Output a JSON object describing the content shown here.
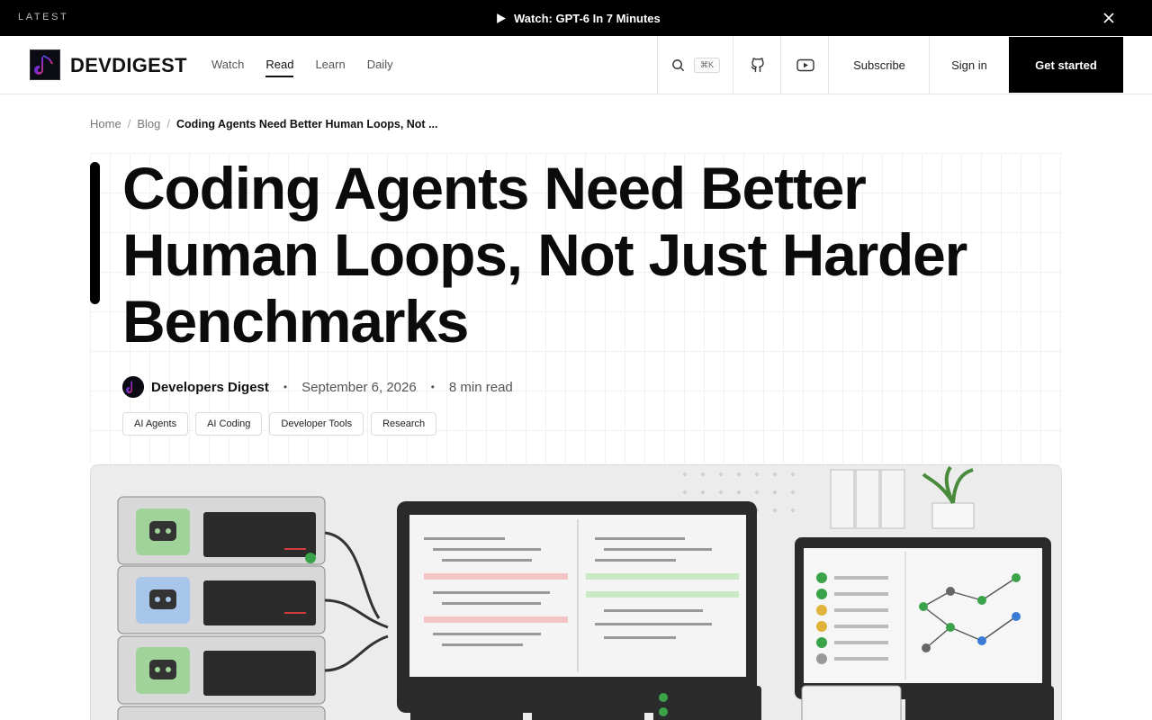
{
  "announcement": {
    "label": "LATEST",
    "link_text": "Watch: GPT-6 In 7 Minutes"
  },
  "header": {
    "brand": "DEVDIGEST",
    "nav": [
      {
        "label": "Watch",
        "active": false
      },
      {
        "label": "Read",
        "active": true
      },
      {
        "label": "Learn",
        "active": false
      },
      {
        "label": "Daily",
        "active": false
      }
    ],
    "search_shortcut": "⌘K",
    "subscribe_label": "Subscribe",
    "signin_label": "Sign in",
    "cta_label": "Get started"
  },
  "breadcrumb": {
    "home": "Home",
    "blog": "Blog",
    "current": "Coding Agents Need Better Human Loops, Not ..."
  },
  "article": {
    "title": "Coding Agents Need Better Human Loops, Not Just Harder Benchmarks",
    "author": "Developers Digest",
    "date": "September 6, 2026",
    "read_time": "8 min read",
    "tags": [
      "AI Agents",
      "AI Coding",
      "Developer Tools",
      "Research"
    ]
  },
  "colors": {
    "topbar_bg": "#000000",
    "cta_bg": "#000000",
    "text_primary": "#111111"
  },
  "icons": {
    "play": "play-icon",
    "close": "close-icon",
    "search": "search-icon",
    "github": "github-icon",
    "youtube": "youtube-icon"
  }
}
